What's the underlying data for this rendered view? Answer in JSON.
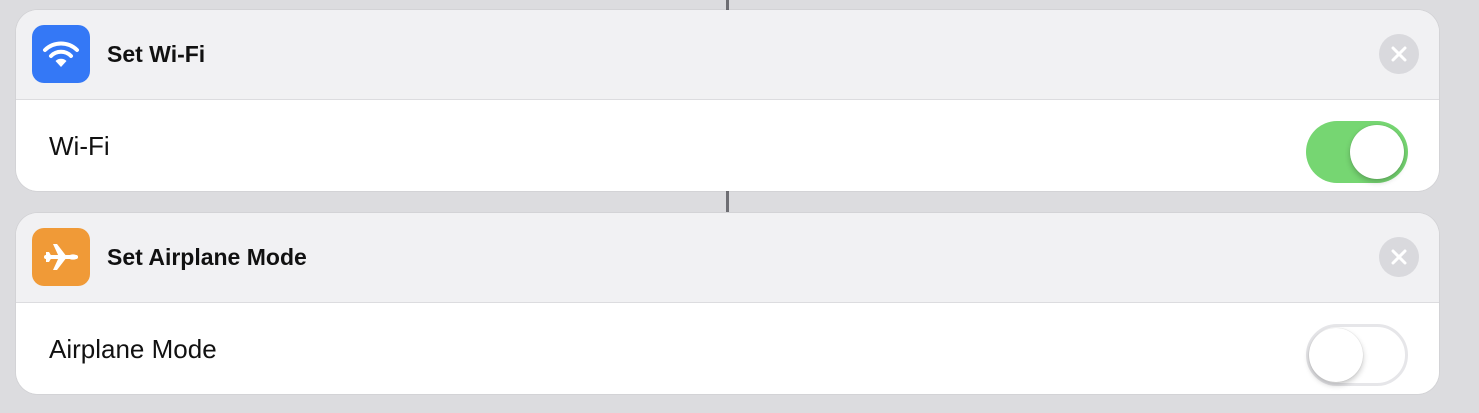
{
  "colors": {
    "wifi_icon_bg": "#3478f6",
    "airplane_icon_bg": "#f09a37",
    "toggle_on": "#76d672"
  },
  "actions": [
    {
      "title": "Set Wi-Fi",
      "icon": "wifi-icon",
      "setting_label": "Wi-Fi",
      "toggle_state": "on"
    },
    {
      "title": "Set Airplane Mode",
      "icon": "airplane-icon",
      "setting_label": "Airplane Mode",
      "toggle_state": "off"
    }
  ]
}
